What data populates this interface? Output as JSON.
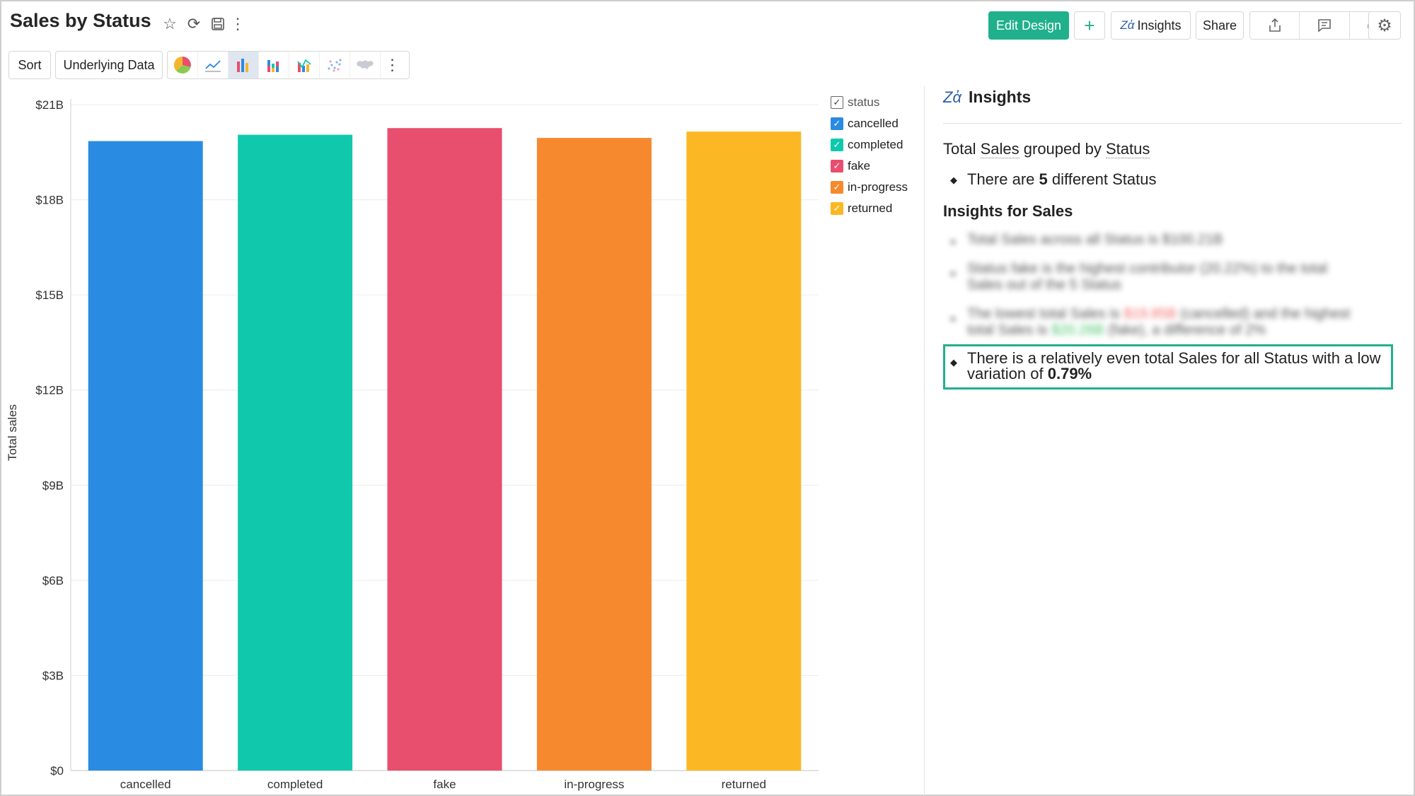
{
  "header": {
    "title": "Sales by Status",
    "edit_design": "Edit Design",
    "add": "+",
    "insights": "Insights",
    "share": "Share"
  },
  "toolbar": {
    "sort": "Sort",
    "underlying_data": "Underlying Data"
  },
  "legend": {
    "title": "status",
    "items": [
      {
        "label": "cancelled",
        "color": "#2a8be2"
      },
      {
        "label": "completed",
        "color": "#10c9ac"
      },
      {
        "label": "fake",
        "color": "#e84e6e"
      },
      {
        "label": "in-progress",
        "color": "#f6892e"
      },
      {
        "label": "returned",
        "color": "#fbb824"
      }
    ]
  },
  "chart_data": {
    "type": "bar",
    "categories": [
      "cancelled",
      "completed",
      "fake",
      "in-progress",
      "returned"
    ],
    "values": [
      19.85,
      20.05,
      20.26,
      19.95,
      20.15
    ],
    "colors": [
      "#2a8be2",
      "#10c9ac",
      "#e84e6e",
      "#f6892e",
      "#fbb824"
    ],
    "ylabel": "Total sales",
    "ylim": [
      0,
      21
    ],
    "yticks": [
      0,
      3,
      6,
      9,
      12,
      15,
      18,
      21
    ],
    "ytick_labels": [
      "$0",
      "$3B",
      "$6B",
      "$9B",
      "$12B",
      "$15B",
      "$18B",
      "$21B"
    ],
    "grid": true
  },
  "insights": {
    "title": "Insights",
    "summary_pre": "Total ",
    "summary_measure": "Sales",
    "summary_mid": " grouped by ",
    "summary_dim": "Status",
    "count_pre": "There are ",
    "count_num": "5",
    "count_post": " different Status",
    "section_title": "Insights for Sales",
    "b1": "Total Sales across all Status is $100.21B",
    "b2a": "Status fake is the highest contributor (20.22%) to the total",
    "b2b": "Sales out of the 5 Status",
    "b3a_pre": "The lowest total Sales is ",
    "b3a_low": "$19.85B",
    "b3a_post": " (cancelled) and the highest",
    "b3b_pre": "total Sales is ",
    "b3b_high": "$20.26B",
    "b3b_post": " (fake), a difference of 2%",
    "b4_line1": "There is a relatively even total Sales for all Status with a low",
    "b4_pre": "variation of ",
    "b4_val": "0.79%"
  }
}
